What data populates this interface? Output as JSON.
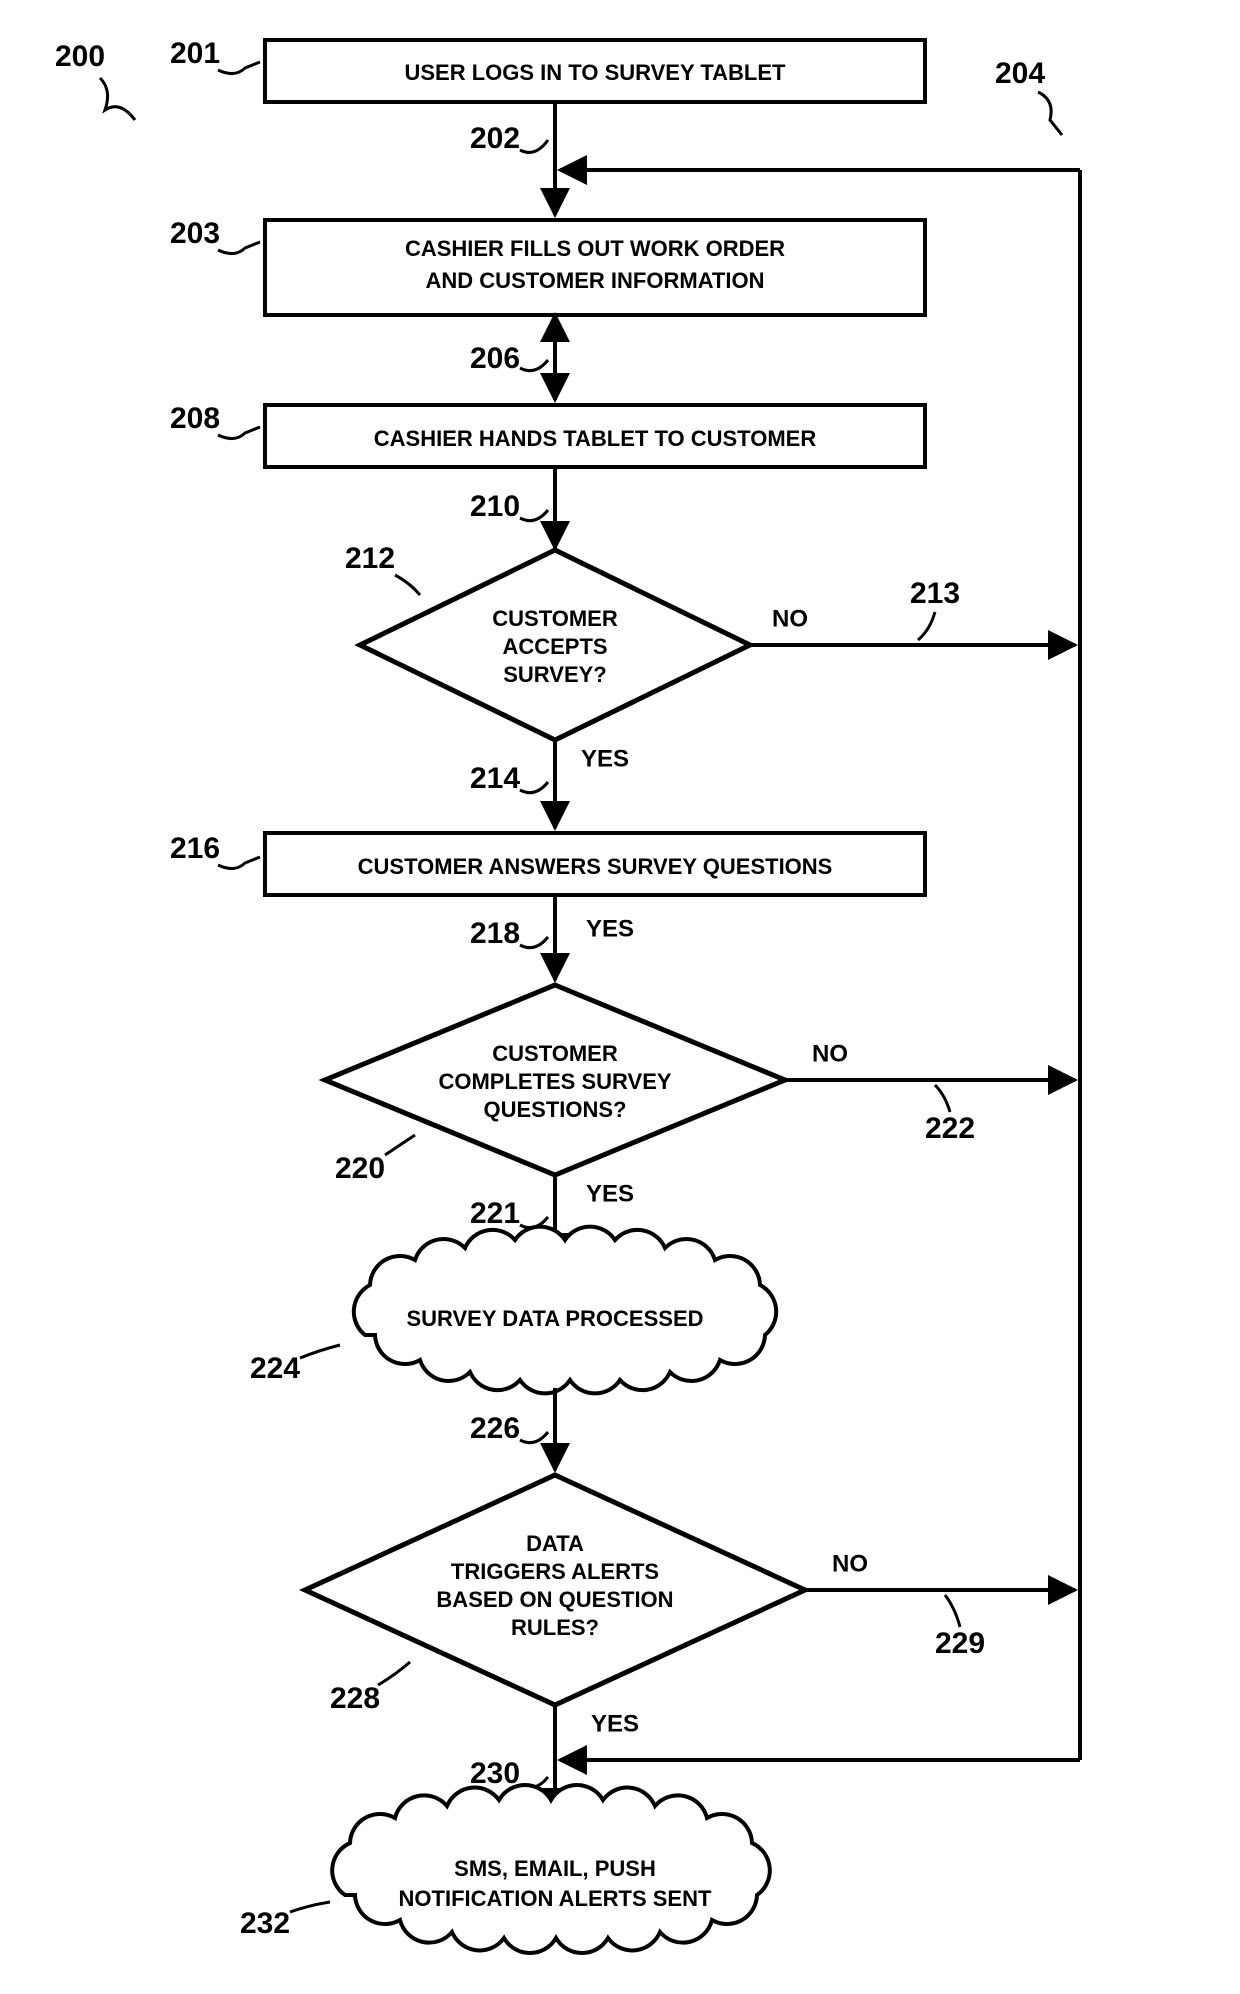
{
  "figure_ref": "200",
  "refs": {
    "r201": "201",
    "r202": "202",
    "r203": "203",
    "r204": "204",
    "r206": "206",
    "r208": "208",
    "r210": "210",
    "r212": "212",
    "r213": "213",
    "r214": "214",
    "r216": "216",
    "r218": "218",
    "r220": "220",
    "r221": "221",
    "r222": "222",
    "r224": "224",
    "r226": "226",
    "r228": "228",
    "r229": "229",
    "r230": "230",
    "r232": "232"
  },
  "nodes": {
    "n201": "USER LOGS IN TO SURVEY TABLET",
    "n203_l1": "CASHIER FILLS OUT WORK ORDER",
    "n203_l2": "AND CUSTOMER INFORMATION",
    "n208": "CASHIER HANDS TABLET TO CUSTOMER",
    "n212_l1": "CUSTOMER",
    "n212_l2": "ACCEPTS",
    "n212_l3": "SURVEY?",
    "n216": "CUSTOMER ANSWERS SURVEY QUESTIONS",
    "n220_l1": "CUSTOMER",
    "n220_l2": "COMPLETES SURVEY",
    "n220_l3": "QUESTIONS?",
    "n224": "SURVEY DATA PROCESSED",
    "n228_l1": "DATA",
    "n228_l2": "TRIGGERS ALERTS",
    "n228_l3": "BASED ON QUESTION",
    "n228_l4": "RULES?",
    "n232_l1": "SMS, EMAIL, PUSH",
    "n232_l2": "NOTIFICATION ALERTS SENT"
  },
  "edges": {
    "yes": "YES",
    "no": "NO"
  }
}
